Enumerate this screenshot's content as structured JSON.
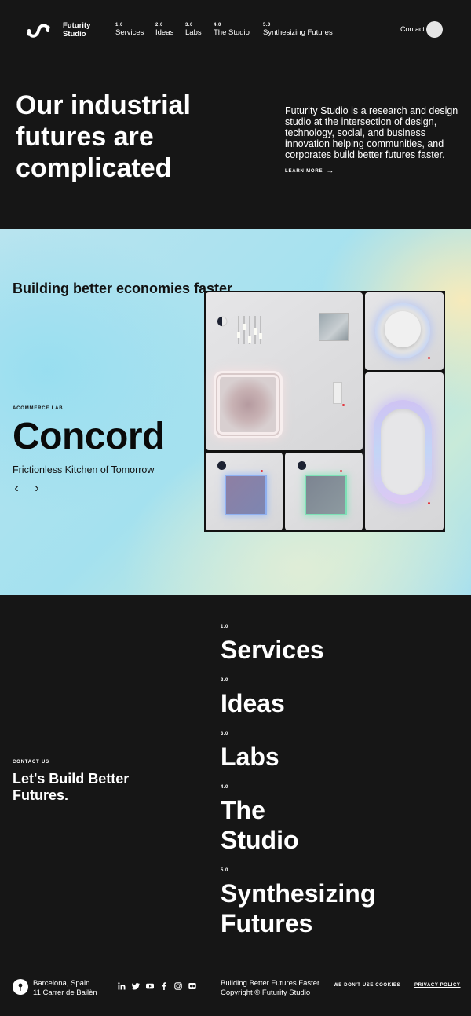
{
  "brand": {
    "line1": "Futurity",
    "line2": "Studio"
  },
  "nav": {
    "items": [
      {
        "num": "1.0",
        "label": "Services"
      },
      {
        "num": "2.0",
        "label": "Ideas"
      },
      {
        "num": "3.0",
        "label": "Labs"
      },
      {
        "num": "4.0",
        "label": "The Studio"
      },
      {
        "num": "5.0",
        "label": "Synthesizing Futures"
      }
    ],
    "contact": "Contact"
  },
  "hero": {
    "title": "Our industrial futures are complicated",
    "description": "Futurity Studio is a research and design studio at the intersection of design, technology, social, and business innovation helping communities, and corporates build better futures faster.",
    "learn_more": "LEARN MORE",
    "learn_more_arrow": "→"
  },
  "showcase": {
    "heading": "Building better economies faster",
    "lab_label": "ACOMMERCE LAB",
    "project_title": "Concord",
    "project_subtitle": "Frictionless Kitchen of Tomorrow",
    "prev_arrow": "‹",
    "next_arrow": "›"
  },
  "footer": {
    "contact_label": "CONTACT US",
    "cta": "Let's Build Better Futures.",
    "menu": [
      {
        "num": "1.0",
        "label": "Services"
      },
      {
        "num": "2.0",
        "label": "Ideas"
      },
      {
        "num": "3.0",
        "label": "Labs"
      },
      {
        "num": "4.0",
        "label": "The Studio"
      },
      {
        "num": "5.0",
        "label": "Synthesizing Futures"
      }
    ],
    "address_line1": "Barcelona, Spain",
    "address_line2": "11 Carrer de Bailèn",
    "socials": [
      "linkedin-icon",
      "twitter-icon",
      "youtube-icon",
      "facebook-icon",
      "instagram-icon",
      "flickr-icon"
    ],
    "tagline": "Building Better Futures Faster",
    "copyright": "Copyright © Futurity Studio",
    "cookies": "WE DON'T USE COOKIES",
    "privacy": "PRIVACY POLICY"
  },
  "colors": {
    "background": "#161616",
    "text": "#ffffff",
    "accent_red": "#e2323a"
  }
}
